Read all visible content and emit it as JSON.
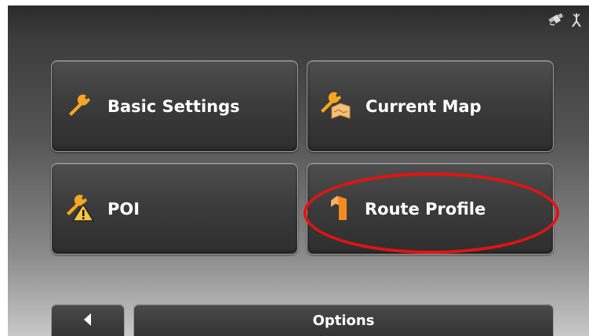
{
  "menu": {
    "basic_settings": {
      "label": "Basic Settings",
      "icon": "wrench-icon"
    },
    "current_map": {
      "label": "Current Map",
      "icon": "map-settings-icon"
    },
    "poi": {
      "label": "POI",
      "icon": "poi-settings-icon"
    },
    "route_profile": {
      "label": "Route Profile",
      "icon": "turn-arrow-icon"
    }
  },
  "footer": {
    "back_icon": "back-arrow-icon",
    "options_label": "Options"
  },
  "status": {
    "icons": [
      "satellite-icon",
      "gps-signal-icon"
    ]
  },
  "colors": {
    "accent": "#f5a623",
    "highlight_ring": "#e31313",
    "text": "#ffffff"
  }
}
